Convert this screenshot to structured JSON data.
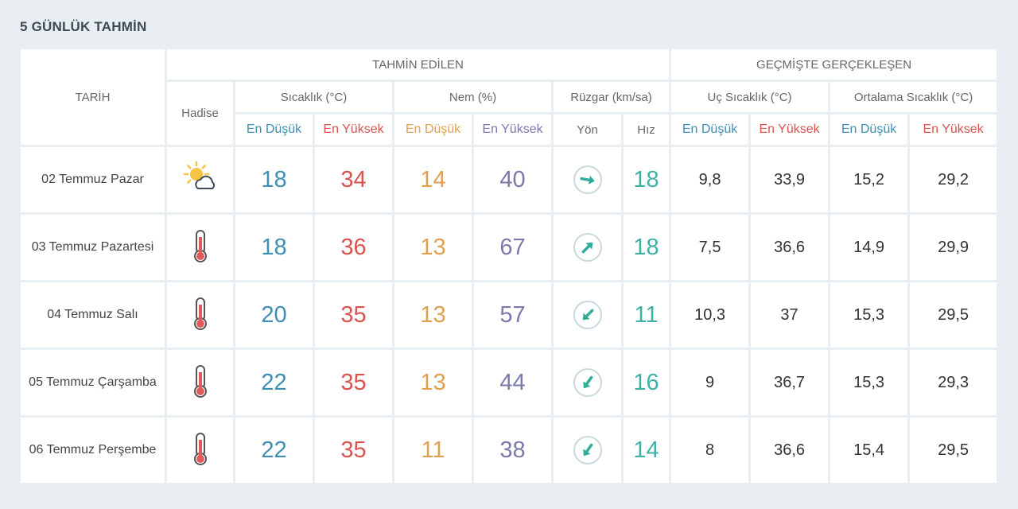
{
  "title": "5 GÜNLÜK TAHMİN",
  "headers": {
    "date": "TARİH",
    "forecast_group": "TAHMİN EDİLEN",
    "past_group": "GEÇMİŞTE GERÇEKLEŞEN",
    "condition": "Hadise",
    "temperature": "Sıcaklık (°C)",
    "humidity": "Nem (%)",
    "wind": "Rüzgar (km/sa)",
    "extreme_temp": "Uç Sıcaklık (°C)",
    "avg_temp": "Ortalama Sıcaklık (°C)",
    "low": "En Düşük",
    "high": "En Yüksek",
    "direction": "Yön",
    "speed": "Hız"
  },
  "colors": {
    "low": "#3f8fb4",
    "high": "#d9534f",
    "humidity_low": "#e0a050",
    "humidity_high": "#7a7aa8",
    "wind": "#3fb1a4"
  },
  "rows": [
    {
      "date": "02 Temmuz Pazar",
      "condition_icon": "partly-cloudy-icon",
      "temp_low": "18",
      "temp_high": "34",
      "hum_low": "14",
      "hum_high": "40",
      "wind_dir_icon": "wind-arrow-east-icon",
      "wind_angle": 100,
      "wind_speed": "18",
      "past_ext_low": "9,8",
      "past_ext_high": "33,9",
      "past_avg_low": "15,2",
      "past_avg_high": "29,2"
    },
    {
      "date": "03 Temmuz Pazartesi",
      "condition_icon": "thermometer-icon",
      "temp_low": "18",
      "temp_high": "36",
      "hum_low": "13",
      "hum_high": "67",
      "wind_dir_icon": "wind-arrow-northeast-icon",
      "wind_angle": 45,
      "wind_speed": "18",
      "past_ext_low": "7,5",
      "past_ext_high": "36,6",
      "past_avg_low": "14,9",
      "past_avg_high": "29,9"
    },
    {
      "date": "04 Temmuz Salı",
      "condition_icon": "thermometer-icon",
      "temp_low": "20",
      "temp_high": "35",
      "hum_low": "13",
      "hum_high": "57",
      "wind_dir_icon": "wind-arrow-southwest-icon",
      "wind_angle": 225,
      "wind_speed": "11",
      "past_ext_low": "10,3",
      "past_ext_high": "37",
      "past_avg_low": "15,3",
      "past_avg_high": "29,5"
    },
    {
      "date": "05 Temmuz Çarşamba",
      "condition_icon": "thermometer-icon",
      "temp_low": "22",
      "temp_high": "35",
      "hum_low": "13",
      "hum_high": "44",
      "wind_dir_icon": "wind-arrow-southwest-icon",
      "wind_angle": 215,
      "wind_speed": "16",
      "past_ext_low": "9",
      "past_ext_high": "36,7",
      "past_avg_low": "15,3",
      "past_avg_high": "29,3"
    },
    {
      "date": "06 Temmuz Perşembe",
      "condition_icon": "thermometer-icon",
      "temp_low": "22",
      "temp_high": "35",
      "hum_low": "11",
      "hum_high": "38",
      "wind_dir_icon": "wind-arrow-southwest-icon",
      "wind_angle": 215,
      "wind_speed": "14",
      "past_ext_low": "8",
      "past_ext_high": "36,6",
      "past_avg_low": "15,4",
      "past_avg_high": "29,5"
    }
  ]
}
